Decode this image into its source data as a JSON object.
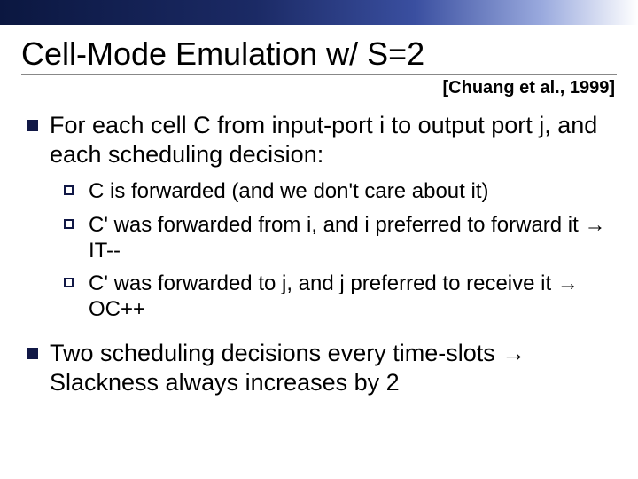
{
  "title": "Cell-Mode Emulation w/ S=2",
  "citation": "[Chuang et al., 1999]",
  "bullets": [
    {
      "text": "For each cell C from input-port i to output port j, and each scheduling decision:",
      "sub": [
        "C is forwarded (and we don't care about it)",
        "C' was forwarded from i, and i preferred to forward it → IT--",
        "C' was forwarded to j, and j preferred to receive it → OC++"
      ]
    },
    {
      "text": "Two scheduling decisions every time-slots → Slackness always increases by 2",
      "sub": []
    }
  ]
}
